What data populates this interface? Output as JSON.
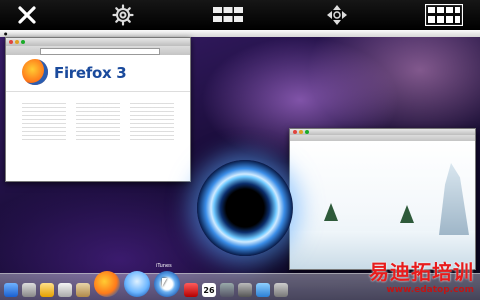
{
  "toolbar": {
    "buttons": [
      {
        "id": "close",
        "icon": "close-icon"
      },
      {
        "id": "settings",
        "icon": "gear-icon"
      },
      {
        "id": "keyboard",
        "icon": "keyboard-icon"
      },
      {
        "id": "move",
        "icon": "move-arrows-icon"
      },
      {
        "id": "grid",
        "icon": "grid-icon"
      }
    ]
  },
  "firefox_window": {
    "logo_text": "Firefox 3"
  },
  "dock": {
    "tooltip": "iTunes",
    "calendar_day": "26"
  },
  "watermark": {
    "main": "易迪拓培训",
    "url": "www.edatop.com"
  },
  "colors": {
    "accent": "#e81c1c",
    "firefox_blue": "#1a4a9c"
  }
}
